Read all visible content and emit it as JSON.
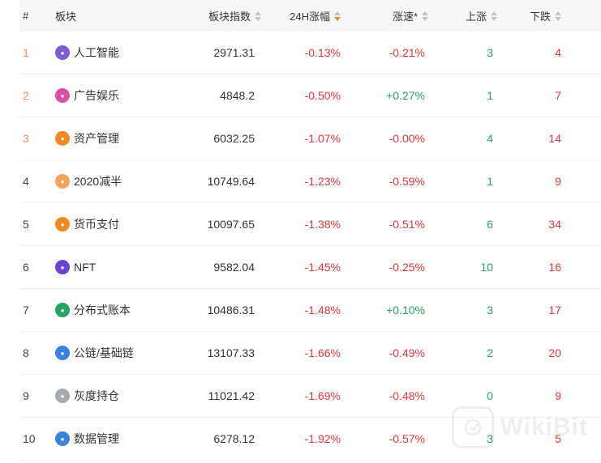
{
  "table": {
    "headers": {
      "idx": "#",
      "name": "板块",
      "index": "板块指数",
      "change24h": "24H涨幅",
      "speed": "涨速*",
      "up": "上涨",
      "down": "下跌"
    },
    "rows": [
      {
        "idx": "1",
        "name": "人工智能",
        "icon": "ai-icon",
        "icon_color": "#7b5cd6",
        "index": "2971.31",
        "change24h": "-0.13%",
        "speed": "-0.21%",
        "up": "3",
        "down": "4"
      },
      {
        "idx": "2",
        "name": "广告娱乐",
        "icon": "media-icon",
        "icon_color": "#d94fa8",
        "index": "4848.2",
        "change24h": "-0.50%",
        "speed": "+0.27%",
        "up": "1",
        "down": "7"
      },
      {
        "idx": "3",
        "name": "资产管理",
        "icon": "asset-icon",
        "icon_color": "#f08a24",
        "index": "6032.25",
        "change24h": "-1.07%",
        "speed": "-0.00%",
        "up": "4",
        "down": "14"
      },
      {
        "idx": "4",
        "name": "2020减半",
        "icon": "halving-icon",
        "icon_color": "#f2a45a",
        "index": "10749.64",
        "change24h": "-1.23%",
        "speed": "-0.59%",
        "up": "1",
        "down": "9"
      },
      {
        "idx": "5",
        "name": "货币支付",
        "icon": "payment-icon",
        "icon_color": "#f08a24",
        "index": "10097.65",
        "change24h": "-1.38%",
        "speed": "-0.51%",
        "up": "6",
        "down": "34"
      },
      {
        "idx": "6",
        "name": "NFT",
        "icon": "nft-icon",
        "icon_color": "#6a42d6",
        "index": "9582.04",
        "change24h": "-1.45%",
        "speed": "-0.25%",
        "up": "10",
        "down": "16"
      },
      {
        "idx": "7",
        "name": "分布式账本",
        "icon": "ledger-icon",
        "icon_color": "#27a363",
        "index": "10486.31",
        "change24h": "-1.48%",
        "speed": "+0.10%",
        "up": "3",
        "down": "17"
      },
      {
        "idx": "8",
        "name": "公链/基础链",
        "icon": "chain-icon",
        "icon_color": "#3b82e0",
        "index": "13107.33",
        "change24h": "-1.66%",
        "speed": "-0.49%",
        "up": "2",
        "down": "20"
      },
      {
        "idx": "9",
        "name": "灰度持仓",
        "icon": "grayscale-icon",
        "icon_color": "#a7aab0",
        "index": "11021.42",
        "change24h": "-1.69%",
        "speed": "-0.48%",
        "up": "0",
        "down": "9"
      },
      {
        "idx": "10",
        "name": "数据管理",
        "icon": "data-icon",
        "icon_color": "#3b82e0",
        "index": "6278.12",
        "change24h": "-1.92%",
        "speed": "-0.57%",
        "up": "3",
        "down": "5"
      }
    ]
  },
  "sort_state": {
    "active_column": "change24h",
    "direction": "descending",
    "active_color": "#f08a24"
  },
  "colors": {
    "negative": "#e2363a",
    "positive": "#27a363",
    "rank_top3": "#e8906a"
  },
  "watermark": {
    "text": "WikiBit"
  }
}
